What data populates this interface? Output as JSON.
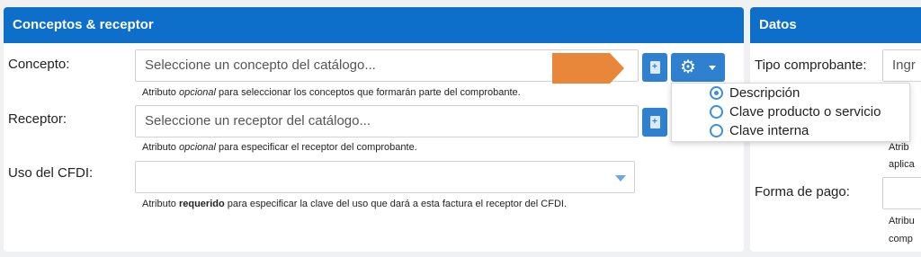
{
  "left_panel": {
    "title": "Conceptos & receptor",
    "concepto": {
      "label": "Concepto:",
      "placeholder": "Seleccione un concepto del catálogo...",
      "hint_pre": "Atributo ",
      "hint_em": "opcional",
      "hint_post": " para seleccionar los conceptos que formarán parte del comprobante."
    },
    "receptor": {
      "label": "Receptor:",
      "placeholder": "Seleccione un receptor del catálogo...",
      "hint_pre": "Atributo ",
      "hint_em": "opcional",
      "hint_post": " para especificar el receptor del comprobante."
    },
    "uso_cfdi": {
      "label": "Uso del CFDI:",
      "value": "",
      "hint_pre": "Atributo ",
      "hint_strong": "requerido",
      "hint_post": " para especificar la clave del uso que dará a esta factura el receptor del CFDI."
    }
  },
  "search_options": {
    "items": [
      {
        "label": "Descripción",
        "selected": true
      },
      {
        "label": "Clave producto o servicio",
        "selected": false
      },
      {
        "label": "Clave interna",
        "selected": false
      }
    ]
  },
  "right_panel": {
    "title": "Datos",
    "tipo_comprobante_label": "Tipo comprobante:",
    "tipo_comprobante_value": "Ingr",
    "hint1_line1": "Atrib",
    "hint1_line2": "aplica",
    "forma_pago_label": "Forma de pago:",
    "hint2_line1": "Atribu",
    "hint2_line2": "comp"
  },
  "icons": {
    "add_concept": "file-plus-icon",
    "add_receptor": "file-plus-icon",
    "settings": "gear-icon",
    "annotation": "arrow-right-icon"
  },
  "colors": {
    "header": "#0d6fc9",
    "button": "#2f80cf",
    "annotation_arrow": "#e8873a",
    "radio": "#3a8fdc"
  }
}
